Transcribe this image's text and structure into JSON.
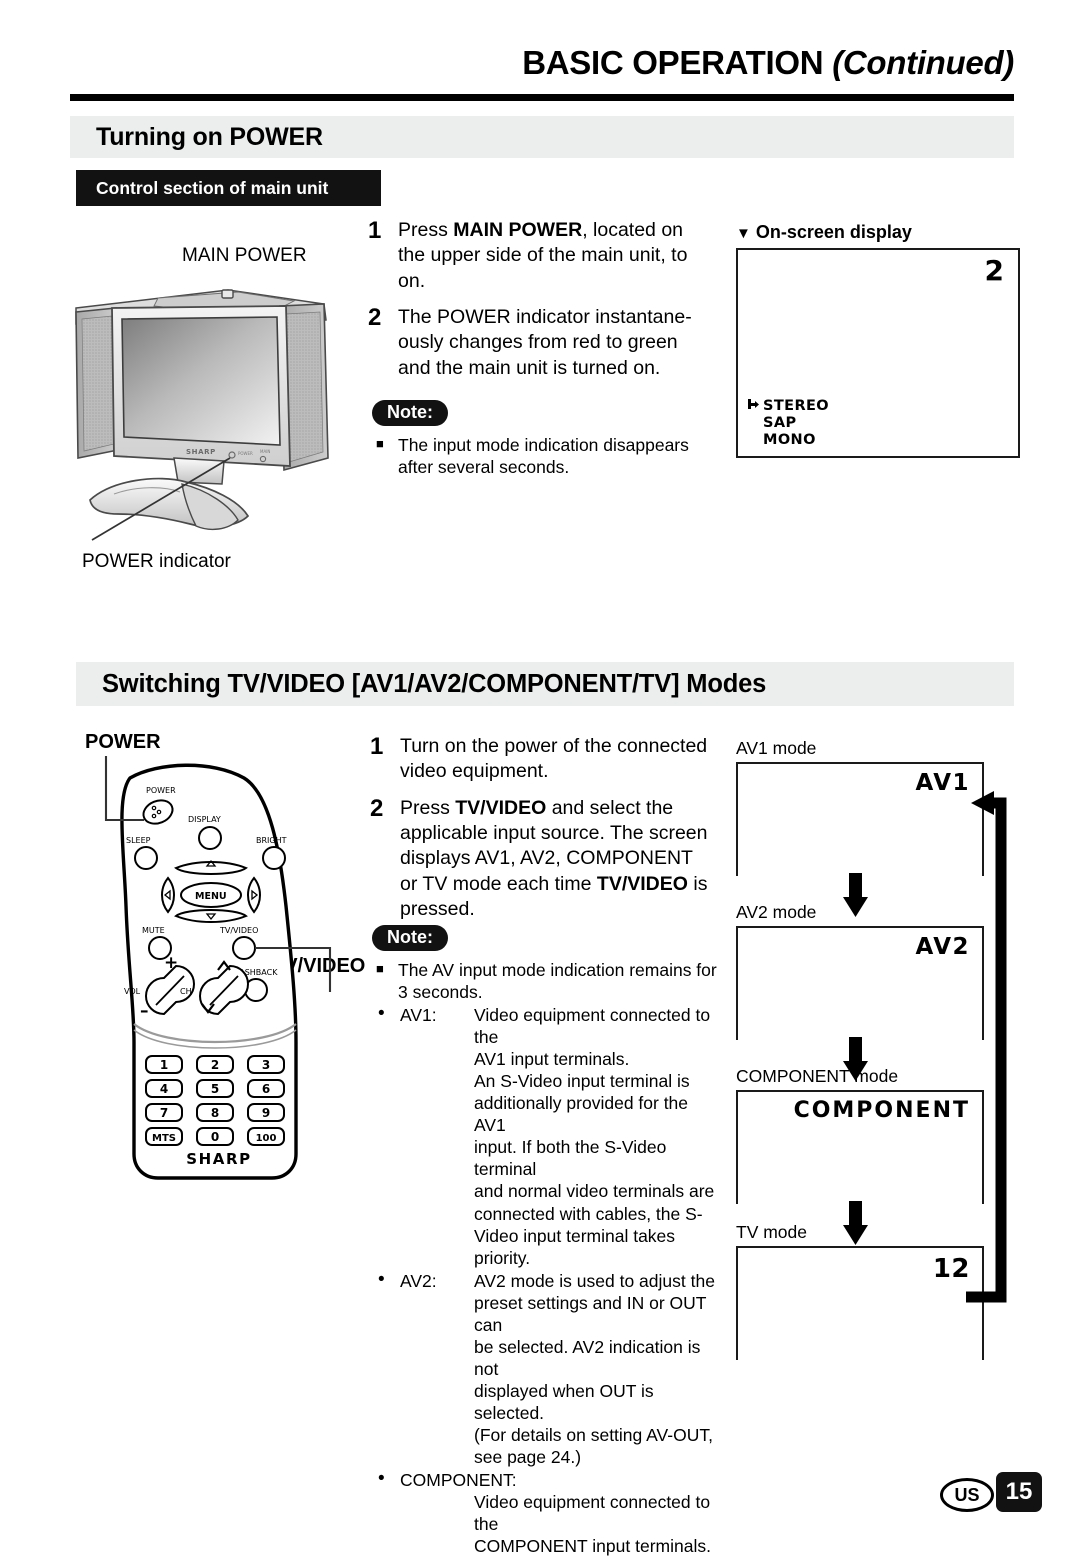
{
  "header": {
    "title_main": "BASIC OPERATION",
    "title_cont": "(Continued)"
  },
  "section1": {
    "heading": "Turning on POWER",
    "subtag": "Control section of main unit",
    "steps": [
      {
        "num": "1",
        "text_pre": "Press ",
        "bold": "MAIN POWER",
        "text_post": ", located on the upper side of the main unit, to on."
      },
      {
        "num": "2",
        "text_pre": "The POWER indicator instantane-ously changes from red to green and the main unit is turned on.",
        "bold": "",
        "text_post": ""
      }
    ],
    "note_label": "Note:",
    "note_items": [
      "The input mode indication disappears after several seconds."
    ],
    "callouts": {
      "main_power": "MAIN POWER",
      "power_indicator": "POWER indicator"
    },
    "osd": {
      "caption_triangle": "▼",
      "caption": "On-screen display",
      "channel": "2",
      "audio_modes": [
        "STEREO",
        "SAP",
        "MONO"
      ]
    }
  },
  "section2": {
    "heading": "Switching TV/VIDEO [AV1/AV2/COMPONENT/TV] Modes",
    "steps": [
      {
        "num": "1",
        "text": "Turn on the power of the connected video equipment."
      },
      {
        "num": "2",
        "text_a": "Press ",
        "bold_a": "TV/VIDEO",
        "text_b": " and select the applicable input source. The screen displays AV1, AV2, COMPONENT or TV mode each time ",
        "bold_b": "TV/VIDEO",
        "text_c": " is pressed."
      }
    ],
    "note_label": "Note:",
    "note_main": "The AV input mode indication remains for 3 seconds.",
    "bullets": [
      {
        "label": "AV1:",
        "lines": [
          "Video equipment connected to the",
          "AV1 input terminals.",
          "An S-Video input terminal is",
          "additionally provided for the AV1",
          "input. If both the S-Video terminal",
          "and normal video terminals are",
          "connected with cables, the S-",
          "Video input terminal takes priority."
        ]
      },
      {
        "label": "AV2:",
        "lines": [
          "AV2 mode is used to adjust the",
          "preset settings and IN or OUT can",
          "be selected. AV2 indication is not",
          "displayed when OUT is selected.",
          "(For details on setting AV-OUT,",
          "see page 24.)"
        ]
      },
      {
        "label": "COMPONENT:",
        "lines": [
          "Video equipment connected to the",
          "COMPONENT input terminals."
        ]
      }
    ],
    "callouts": {
      "power": "POWER",
      "tv_video": "TV/VIDEO"
    },
    "remote": {
      "power": "POWER",
      "display": "DISPLAY",
      "sleep": "SLEEP",
      "bright": "BRIGHT",
      "menu": "MENU",
      "mute": "MUTE",
      "tvvideo": "TV/VIDEO",
      "flashback": "FLASHBACK",
      "vol": "VOL",
      "ch": "CH",
      "vol_plus": "+",
      "vol_minus": "–",
      "keys": [
        "1",
        "2",
        "3",
        "4",
        "5",
        "6",
        "7",
        "8",
        "9",
        "MTS",
        "0",
        "100"
      ],
      "brand": "SHARP"
    },
    "modes": [
      {
        "caption": "AV1 mode",
        "label": "AV1"
      },
      {
        "caption": "AV2 mode",
        "label": "AV2"
      },
      {
        "caption": "COMPONENT mode",
        "label": "COMPONENT"
      },
      {
        "caption": "TV mode",
        "label": "12"
      }
    ]
  },
  "footer": {
    "region": "US",
    "page": "15"
  }
}
